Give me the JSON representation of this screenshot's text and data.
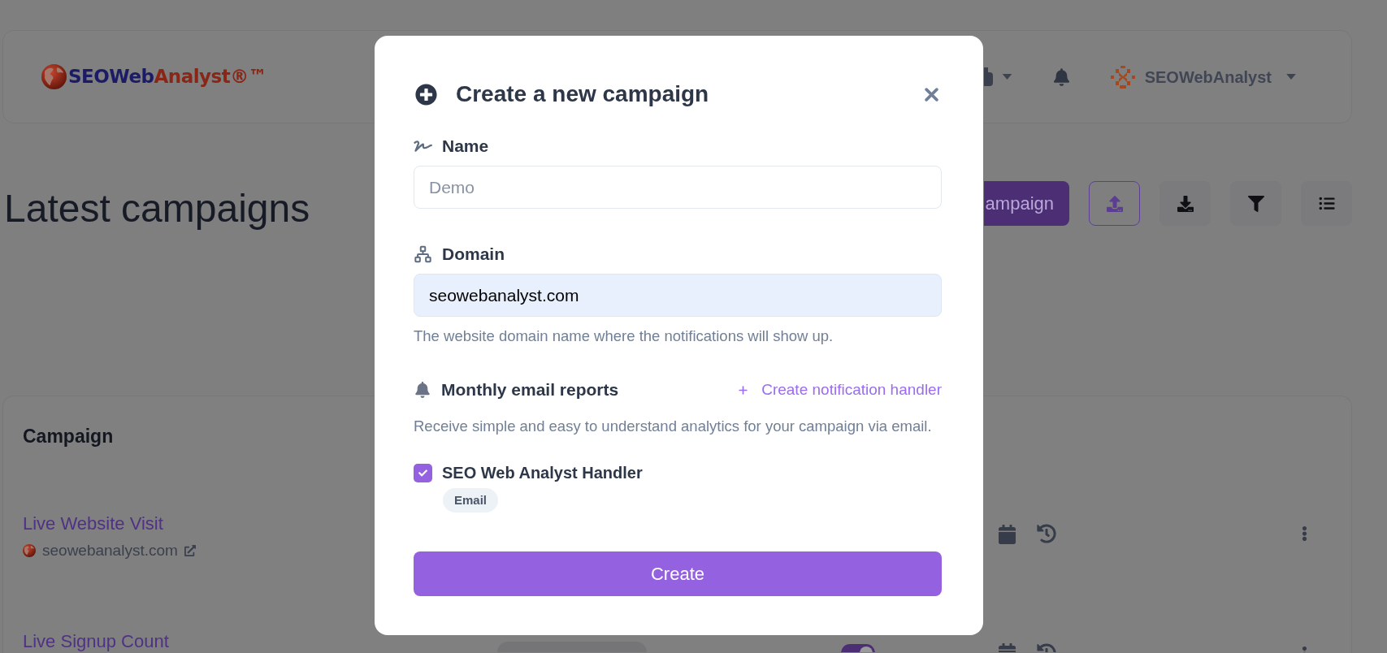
{
  "header": {
    "logo": {
      "brand_first": "SEOWeb",
      "brand_second": "Analyst®™"
    },
    "user": {
      "name": "SEOWebAnalyst"
    }
  },
  "page": {
    "title": "Latest campaigns",
    "actions": [
      {
        "kind": "primary",
        "label": "ampaign"
      },
      {
        "kind": "upload"
      },
      {
        "kind": "download"
      },
      {
        "kind": "filter"
      },
      {
        "kind": "list"
      }
    ]
  },
  "table": {
    "columns": [
      "Campaign"
    ],
    "rows": [
      {
        "name": "Live Website Visit",
        "domain": "seowebanalyst.com"
      },
      {
        "name": "Live Signup Count",
        "enabled": true
      }
    ]
  },
  "modal": {
    "title": "Create a new campaign",
    "fields": [
      {
        "kind": "name",
        "label": "Name",
        "placeholder": "Demo",
        "autofilled": false
      },
      {
        "kind": "domain",
        "label": "Domain",
        "value": "seowebanalyst.com",
        "autofilled": true,
        "help": "The website domain name where the notifications will show up."
      }
    ],
    "reports": {
      "title": "Monthly email reports",
      "link": "Create notification handler",
      "description": "Receive simple and easy to understand analytics for your campaign via email.",
      "handlers": [
        {
          "label": "SEO Web Analyst Handler",
          "checked": true,
          "tags": [
            "Email"
          ]
        }
      ]
    },
    "submit": "Create"
  }
}
